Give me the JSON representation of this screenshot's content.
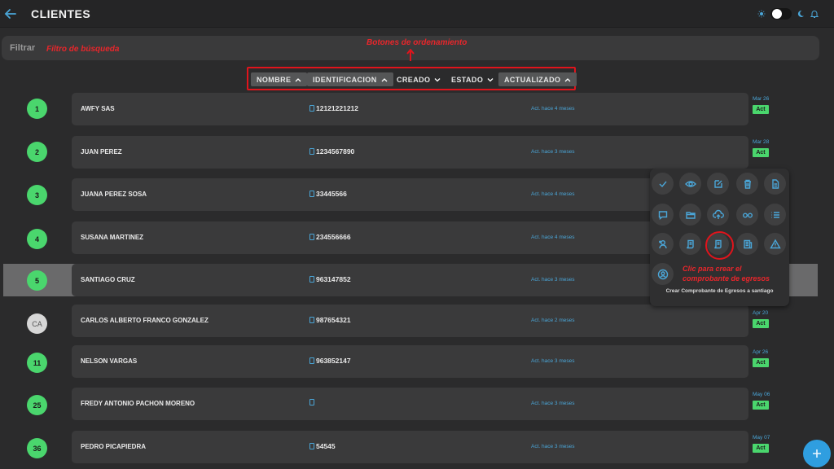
{
  "header": {
    "title": "CLIENTES"
  },
  "filter": {
    "label": "Filtrar"
  },
  "annotations": {
    "filter": "Filtro de búsqueda",
    "sort": "Botones de ordenamiento",
    "create_egress_line1": "Clic para crear el",
    "create_egress_line2": "comprobante de egresos"
  },
  "sort_buttons": [
    {
      "label": "NOMBRE",
      "state": "active",
      "arrow": "up"
    },
    {
      "label": "IDENTIFICACION",
      "state": "active",
      "arrow": "up"
    },
    {
      "label": "CREADO",
      "state": "inactive",
      "arrow": "down"
    },
    {
      "label": "ESTADO",
      "state": "inactive",
      "arrow": "down"
    },
    {
      "label": "ACTUALIZADO",
      "state": "active",
      "arrow": "up"
    }
  ],
  "rows": [
    {
      "badge": "1",
      "name": "AWFY SAS",
      "id": "12121221212",
      "updated": "Act. hace 4 meses",
      "date": "Mar 26",
      "status": "Act"
    },
    {
      "badge": "2",
      "name": "JUAN PEREZ",
      "id": "1234567890",
      "updated": "Act. hace 3 meses",
      "date": "Mar 28",
      "status": "Act"
    },
    {
      "badge": "3",
      "name": "JUANA PEREZ SOSA",
      "id": "33445566",
      "updated": "Act. hace 4 meses",
      "date": "",
      "status": ""
    },
    {
      "badge": "4",
      "name": "SUSANA MARTINEZ",
      "id": "234556666",
      "updated": "Act. hace 4 meses",
      "date": "",
      "status": ""
    },
    {
      "badge": "5",
      "name": "SANTIAGO CRUZ",
      "id": "963147852",
      "updated": "Act. hace 3 meses",
      "date": "",
      "status": ""
    },
    {
      "badge": "CA",
      "name": "CARLOS ALBERTO FRANCO GONZALEZ",
      "id": "987654321",
      "updated": "Act. hace 2 meses",
      "date": "Apr 20",
      "status": "Act"
    },
    {
      "badge": "11",
      "name": "NELSON VARGAS",
      "id": "963852147",
      "updated": "Act. hace 3 meses",
      "date": "Apr 26",
      "status": "Act"
    },
    {
      "badge": "25",
      "name": "FREDY ANTONIO PACHON MORENO",
      "id": "",
      "updated": "Act. hace 3 meses",
      "date": "May 06",
      "status": "Act"
    },
    {
      "badge": "36",
      "name": "PEDRO PICAPIEDRA",
      "id": "54545",
      "updated": "Act. hace 3 meses",
      "date": "May 07",
      "status": "Act"
    }
  ],
  "actions_panel": {
    "caption": "Crear Comprobante de Egresos a santiago",
    "icons": [
      "check-icon",
      "eye-icon",
      "edit-icon",
      "trash-icon",
      "document-icon",
      "comment-icon",
      "folder-icon",
      "cloud-upload-icon",
      "glasses-icon",
      "list-icon",
      "add-user-icon",
      "receipt-icon",
      "egress-receipt-icon",
      "newspaper-icon",
      "warning-icon",
      "user-circle-icon"
    ]
  },
  "colors": {
    "accent": "#4aa6d8",
    "green": "#4ad66d",
    "annotation_red": "#e0141c"
  }
}
